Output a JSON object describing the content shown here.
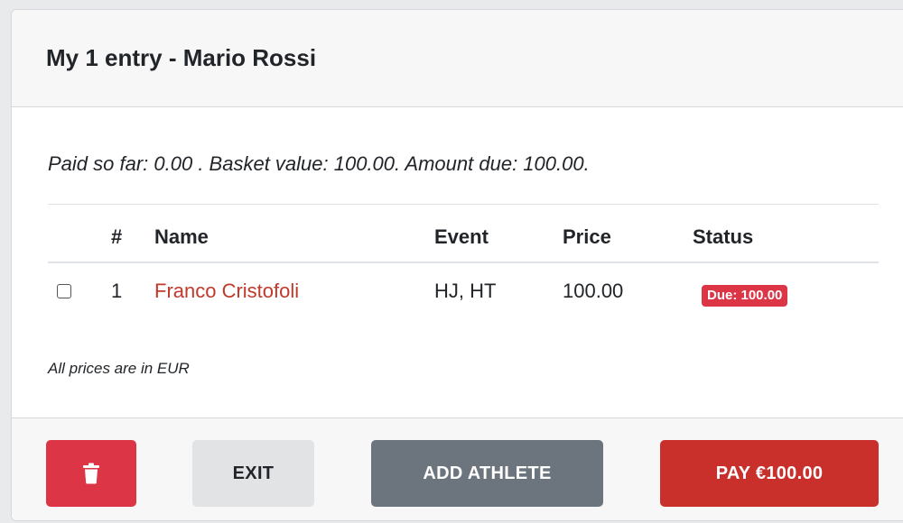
{
  "header": {
    "title": "My 1 entry - Mario Rossi"
  },
  "summary": {
    "text": "Paid so far: 0.00 . Basket value: 100.00. Amount due: 100.00."
  },
  "table": {
    "columns": {
      "number": "#",
      "name": "Name",
      "event": "Event",
      "price": "Price",
      "status": "Status"
    },
    "rows": [
      {
        "checked": false,
        "number": "1",
        "name": "Franco Cristofoli",
        "event": "HJ, HT",
        "price": "100.00",
        "status": "Due: 100.00"
      }
    ]
  },
  "note": "All prices are in EUR",
  "footer": {
    "delete_icon": "trash-icon",
    "exit_label": "EXIT",
    "add_label": "ADD ATHLETE",
    "pay_label": "PAY €100.00"
  },
  "colors": {
    "danger": "#dc3545",
    "pay": "#c9302c",
    "secondary": "#6c757d",
    "link": "#c0392b"
  }
}
